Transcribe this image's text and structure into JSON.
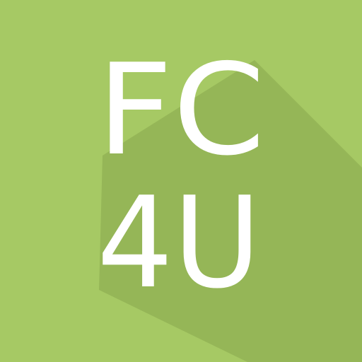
{
  "logo": {
    "line1": "FC",
    "line2": "4U",
    "colors": {
      "background": "#A6C964",
      "shadow": "#95B657",
      "text": "#FFFFFF"
    }
  }
}
